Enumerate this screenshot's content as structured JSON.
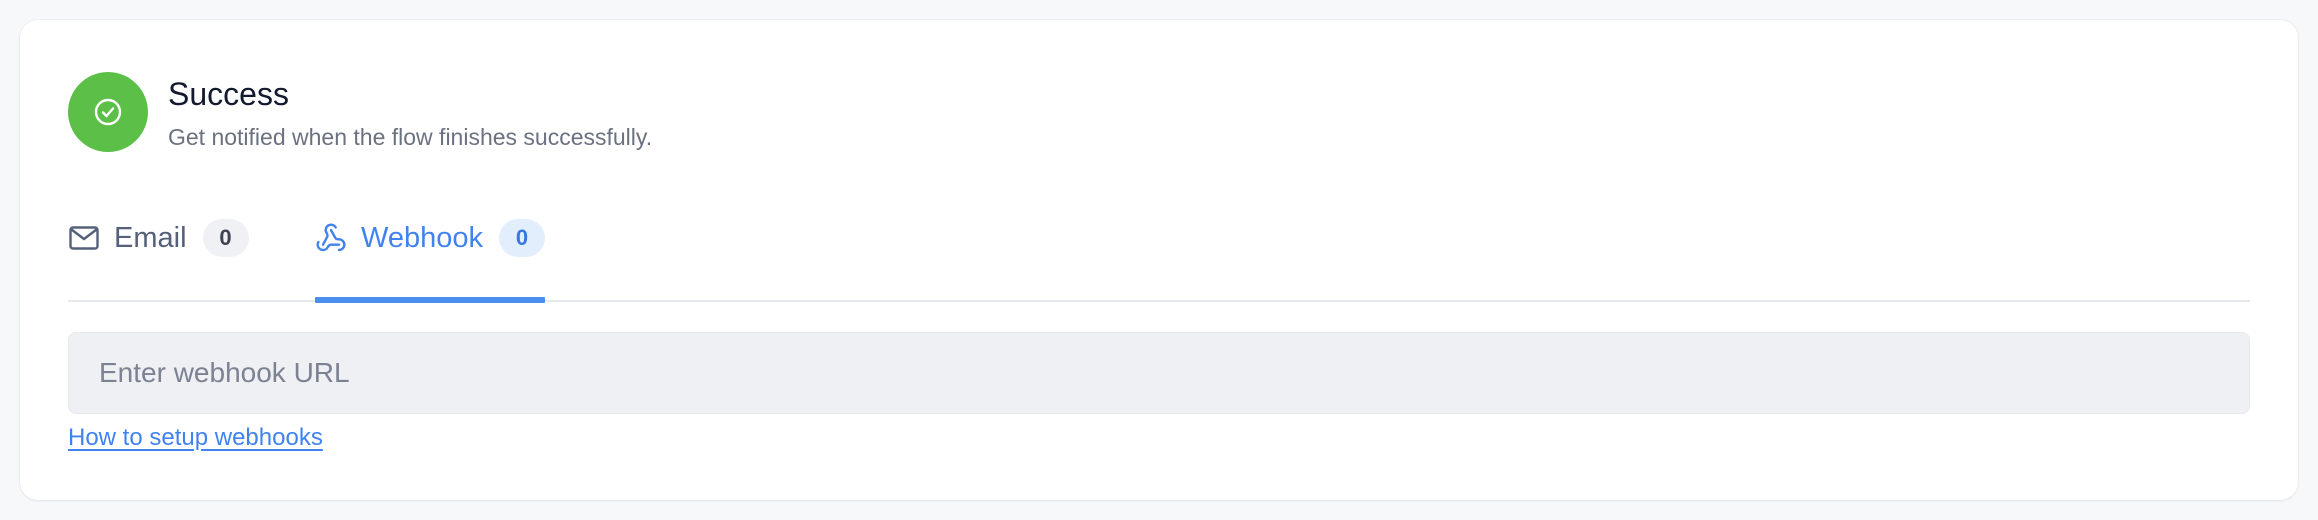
{
  "notification": {
    "title": "Success",
    "description": "Get notified when the flow finishes successfully.",
    "status_color": "#5cc048",
    "status_icon": "check-circle-icon"
  },
  "tabs": [
    {
      "label": "Email",
      "count": "0",
      "icon": "mail-icon",
      "active": false
    },
    {
      "label": "Webhook",
      "count": "0",
      "icon": "webhook-icon",
      "active": true
    }
  ],
  "webhook": {
    "url_value": "",
    "url_placeholder": "Enter webhook URL",
    "help_link_label": "How to setup webhooks"
  },
  "colors": {
    "accent": "#4183ee",
    "success": "#5cc048"
  }
}
